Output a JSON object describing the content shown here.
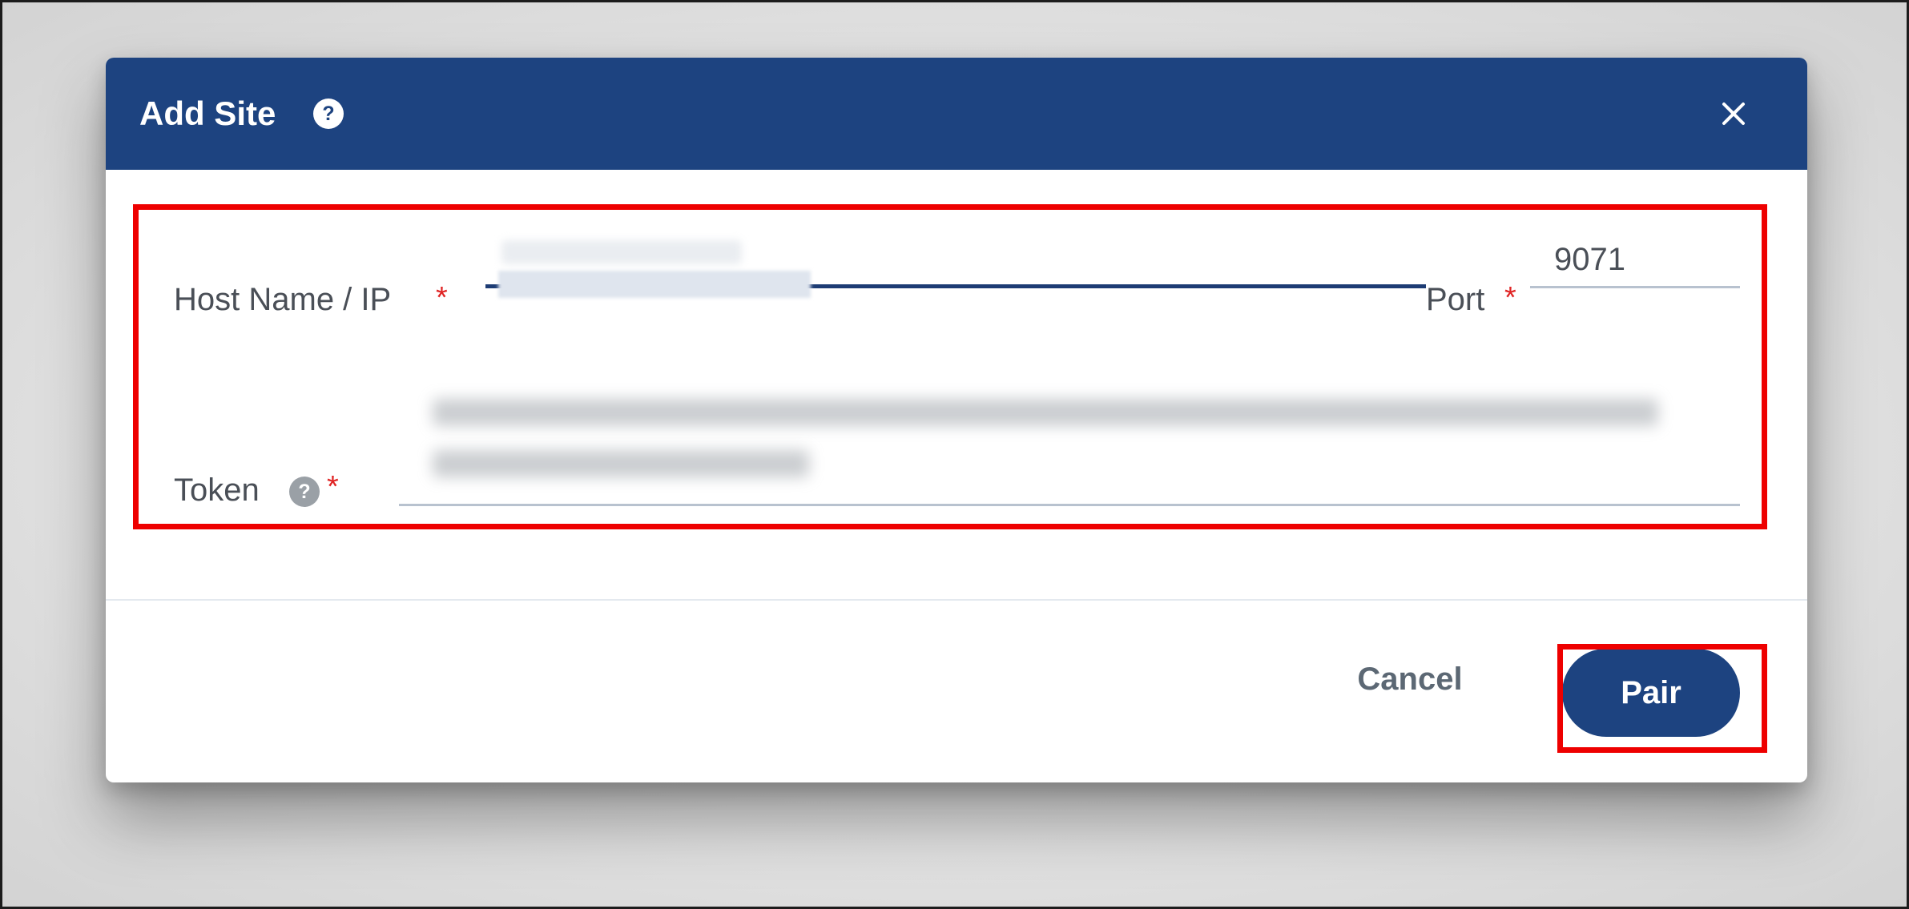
{
  "dialog": {
    "title": "Add Site",
    "header_icons": [
      "help-icon",
      "close-icon"
    ]
  },
  "form": {
    "host": {
      "label": "Host Name / IP",
      "required_mark": "*",
      "value_state": "redacted"
    },
    "port": {
      "label": "Port",
      "required_mark": "*",
      "value": "9071"
    },
    "token": {
      "label": "Token",
      "required_mark": "*",
      "value_state": "redacted",
      "help_icon": "help-icon"
    }
  },
  "footer": {
    "cancel_label": "Cancel",
    "pair_label": "Pair"
  },
  "colors": {
    "header": "#1d4380",
    "primary_button": "#1d4380",
    "required": "#e02424",
    "highlight": "#ee0000"
  }
}
